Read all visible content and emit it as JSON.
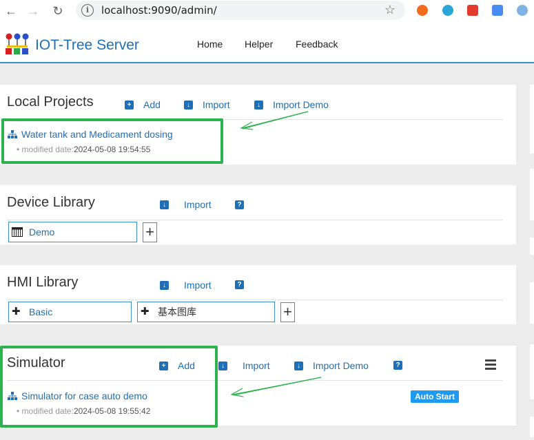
{
  "browser": {
    "url": "localhost:9090/admin/"
  },
  "header": {
    "title": "IOT-Tree Server",
    "menu": [
      "Home",
      "Helper",
      "Feedback"
    ]
  },
  "local_projects": {
    "title": "Local Projects",
    "actions": {
      "add": "Add",
      "import": "Import",
      "import_demo": "Import Demo"
    },
    "item": {
      "name": "Water tank and Medicament dosing",
      "meta_label": "modified date:",
      "meta_value": "2024-05-08 19:54:55"
    }
  },
  "device_library": {
    "title": "Device Library",
    "actions": {
      "import": "Import",
      "help": "?"
    },
    "items": [
      "Demo"
    ],
    "add": "+"
  },
  "hmi_library": {
    "title": "HMI Library",
    "actions": {
      "import": "Import",
      "help": "?"
    },
    "items": [
      "Basic",
      "基本图库"
    ],
    "add": "+"
  },
  "simulator": {
    "title": "Simulator",
    "actions": {
      "add": "Add",
      "import": "Import",
      "import_demo": "Import Demo",
      "help": "?"
    },
    "item": {
      "name": "Simulator for case auto demo",
      "meta_label": "modified date:",
      "meta_value": "2024-05-08 19:55:42",
      "badge": "Auto Start"
    }
  },
  "colors": {
    "link": "#1e6fb6",
    "highlight": "#2eb24e",
    "header_border": "#3a8fd0",
    "badge": "#1e9bf0"
  }
}
